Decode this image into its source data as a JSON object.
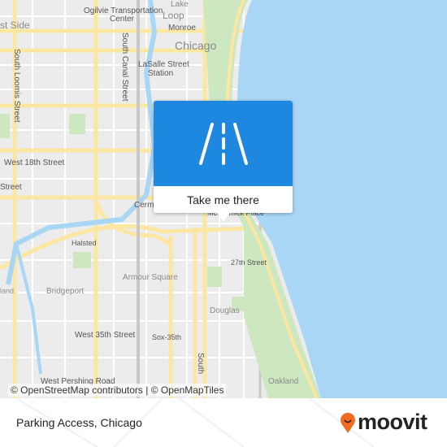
{
  "map": {
    "labels": {
      "lake": "Lake",
      "ogilvie": "Ogilvie Transportation",
      "ogilvie2": "Center",
      "loop": "Loop",
      "monroe": "Monroe",
      "chicago": "Chicago",
      "lasalle": "LaSalle Street",
      "lasalle2": "Station",
      "west_side": "st Side",
      "loomis": "South Loomis Street",
      "canal": "South Canal Street",
      "w18": "West 18th Street",
      "street": "Street",
      "cermak": "Cerma",
      "mccormick": "McCormick Place",
      "halsted": "Halsted",
      "s27": "27th Street",
      "armour": "Armour Square",
      "bridgeport": "Bridgeport",
      "land": "land",
      "douglas": "Douglas",
      "w35": "West 35th Street",
      "sox": "Sox-35th",
      "south": "South",
      "pershing": "West Pershing Road",
      "oakland": "Oakland"
    },
    "attribution": "© OpenStreetMap contributors | © OpenMapTiles",
    "colors": {
      "water": "#a9d6f5",
      "park": "#cde8c0",
      "road": "#fbe7a1",
      "land": "#ececec"
    }
  },
  "popup": {
    "icon": "road-icon",
    "button_label": "Take me there",
    "color": "#1e87e0"
  },
  "footer": {
    "place": "Parking Access, Chicago",
    "logo_text": "moovit",
    "logo_color": "#f26b21"
  }
}
